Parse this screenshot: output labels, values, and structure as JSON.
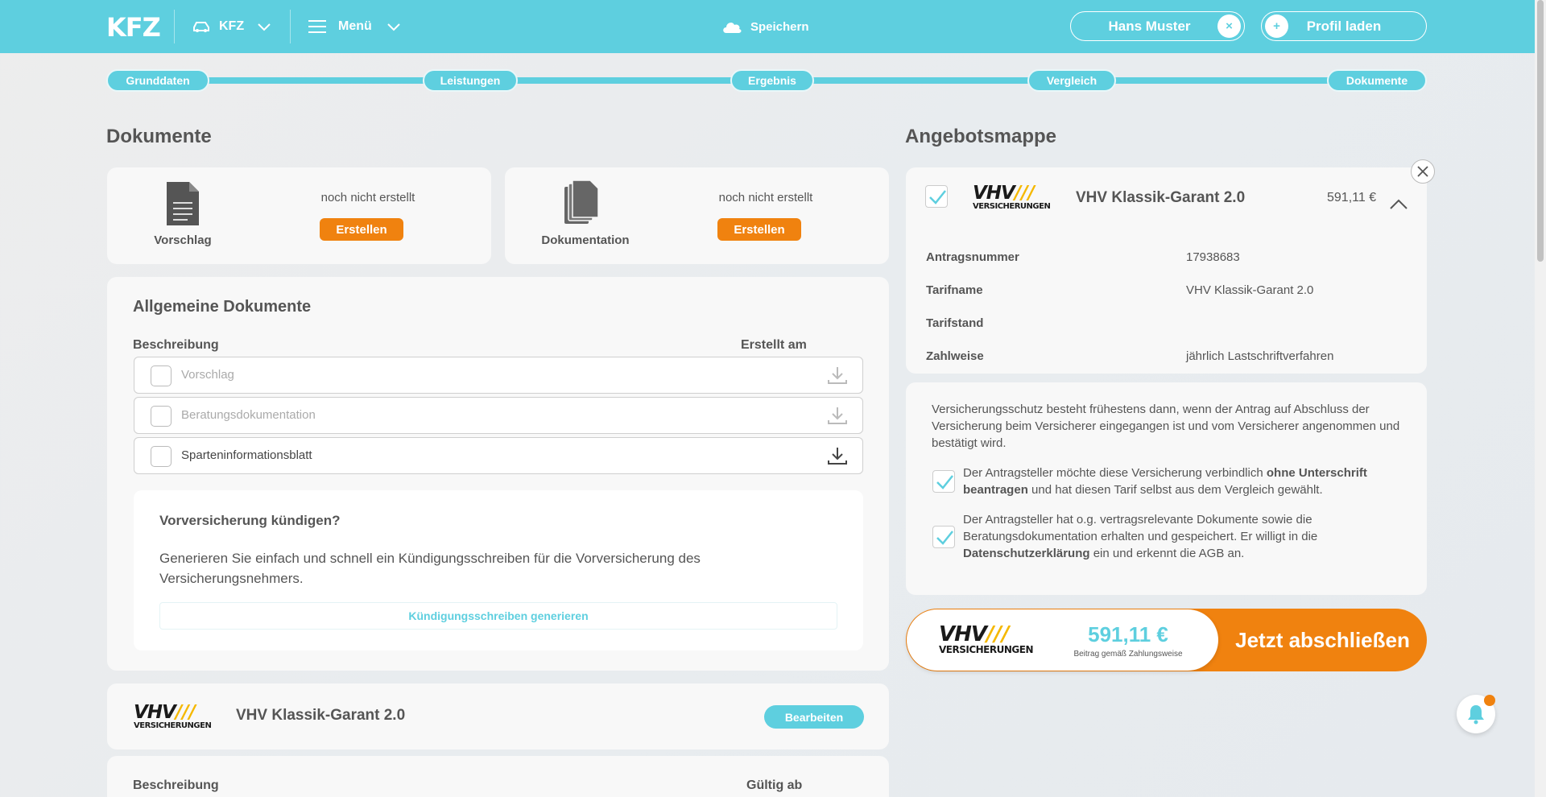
{
  "header": {
    "logo": "KFZ",
    "product": "KFZ",
    "menu": "Menü",
    "save": "Speichern",
    "user": "Hans Muster",
    "user_clear": "×",
    "load_plus": "+",
    "load_profile": "Profil laden"
  },
  "steps": [
    "Grunddaten",
    "Leistungen",
    "Ergebnis",
    "Vergleich",
    "Dokumente"
  ],
  "documents": {
    "title": "Dokumente",
    "cards": [
      {
        "name": "Vorschlag",
        "status": "noch nicht erstellt",
        "button": "Erstellen"
      },
      {
        "name": "Dokumentation",
        "status": "noch nicht erstellt",
        "button": "Erstellen"
      }
    ]
  },
  "general": {
    "title": "Allgemeine Dokumente",
    "col_desc": "Beschreibung",
    "col_created": "Erstellt am",
    "rows": [
      "Vorschlag",
      "Beratungsdokumentation",
      "Sparteninformationsblatt"
    ]
  },
  "cancel": {
    "title": "Vorversicherung kündigen?",
    "text": "Generieren Sie einfach und schnell ein Kündigungsschreiben für die Vorversicherung des Versicherungsnehmers.",
    "button": "Kündigungsschreiben generieren"
  },
  "tariff_card": {
    "logo_big": "VHV",
    "logo_small": "VERSICHERUNGEN",
    "name": "VHV Klassik-Garant 2.0",
    "button": "Bearbeiten",
    "col_desc": "Beschreibung",
    "col_valid": "Gültig ab"
  },
  "offer": {
    "title": "Angebotsmappe",
    "logo_big": "VHV",
    "logo_small": "VERSICHERUNGEN",
    "tariff": "VHV Klassik-Garant 2.0",
    "price": "591,11 €",
    "details": [
      {
        "key": "Antragsnummer",
        "value": "17938683"
      },
      {
        "key": "Tarifname",
        "value": "VHV Klassik-Garant 2.0"
      },
      {
        "key": "Tarifstand",
        "value": ""
      },
      {
        "key": "Zahlweise",
        "value": "jährlich Lastschriftverfahren"
      }
    ]
  },
  "terms": {
    "intro": "Versicherungsschutz besteht frühestens dann, wenn der Antrag auf Abschluss der Versicherung beim Versicherer eingegangen ist und vom Versicherer angenommen und bestätigt wird.",
    "c1_a": "Der Antragsteller möchte diese Versicherung verbindlich ",
    "c1_b": "ohne Unterschrift beantragen",
    "c1_c": " und hat diesen Tarif selbst aus dem Vergleich gewählt.",
    "c2_a": "Der Antragsteller hat o.g. vertragsrelevante Dokumente sowie die Beratungsdokumentation erhalten und gespeichert. Er willigt in die ",
    "c2_b": "Datenschutzerklärung",
    "c2_c": " ein und erkennt die AGB an."
  },
  "checkout": {
    "logo_big": "VHV",
    "logo_small": "VERSICHERUNGEN",
    "price": "591,11 €",
    "price_note": "Beitrag gemäß Zahlungsweise",
    "button": "Jetzt abschließen"
  },
  "colors": {
    "accent": "#5ecfdf",
    "orange": "#f0820f"
  }
}
